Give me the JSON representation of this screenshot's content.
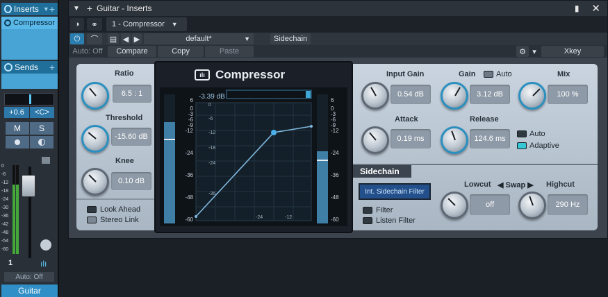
{
  "strip": {
    "inserts_label": "Inserts",
    "compressor_item": "Compressor",
    "sends_label": "Sends",
    "pan_value": "+0.6",
    "pan_center": "<C>",
    "mute": "M",
    "solo": "S",
    "fader_scale": [
      "0",
      "-6",
      "-12",
      "-18",
      "-24",
      "-30",
      "-36",
      "-42",
      "-48",
      "-54",
      "-60"
    ],
    "channel_number": "1",
    "automation": "Auto: Off",
    "channel_name": "Guitar"
  },
  "window": {
    "title": "Guitar - Inserts",
    "tab": "1 - Compressor",
    "preset": "default*",
    "sidechain_btn": "Sidechain",
    "auto_off": "Auto: Off",
    "compare": "Compare",
    "copy": "Copy",
    "paste": "Paste",
    "xkey": "Xkey"
  },
  "plugin": {
    "brand": "Compressor",
    "ratio": {
      "label": "Ratio",
      "value": "6.5 : 1"
    },
    "threshold": {
      "label": "Threshold",
      "value": "-15.60 dB"
    },
    "knee": {
      "label": "Knee",
      "value": "0.10 dB"
    },
    "look_ahead": "Look Ahead",
    "stereo_link": "Stereo Link",
    "input_gain": {
      "label": "Input Gain",
      "value": "0.54 dB"
    },
    "gain": {
      "label": "Gain",
      "value": "3.12 dB",
      "auto": "Auto"
    },
    "mix": {
      "label": "Mix",
      "value": "100 %"
    },
    "attack": {
      "label": "Attack",
      "value": "0.19 ms"
    },
    "release": {
      "label": "Release",
      "value": "124.6 ms",
      "auto": "Auto",
      "adaptive": "Adaptive"
    },
    "sidechain": {
      "title": "Sidechain",
      "int_btn": "Int. Sidechain Filter",
      "filter": "Filter",
      "listen": "Listen Filter",
      "lowcut_label": "Lowcut",
      "swap": "Swap",
      "highcut_label": "Highcut",
      "lowcut_value": "off",
      "highcut_value": "290 Hz"
    },
    "graph": {
      "readout": "-3.39 dB",
      "left_scale": [
        "6",
        "0",
        "-3",
        "-6",
        "-9",
        "-12",
        "-24",
        "-36",
        "-48",
        "-60"
      ],
      "right_scale": [
        "6",
        "0",
        "-3",
        "-6",
        "-9",
        "-12",
        "-24",
        "-36",
        "-48",
        "-60"
      ],
      "y_ticks": [
        "0",
        "-6",
        "-12",
        "-18",
        "-24",
        "-36"
      ],
      "x_ticks": [
        "-24",
        "-12"
      ]
    }
  }
}
